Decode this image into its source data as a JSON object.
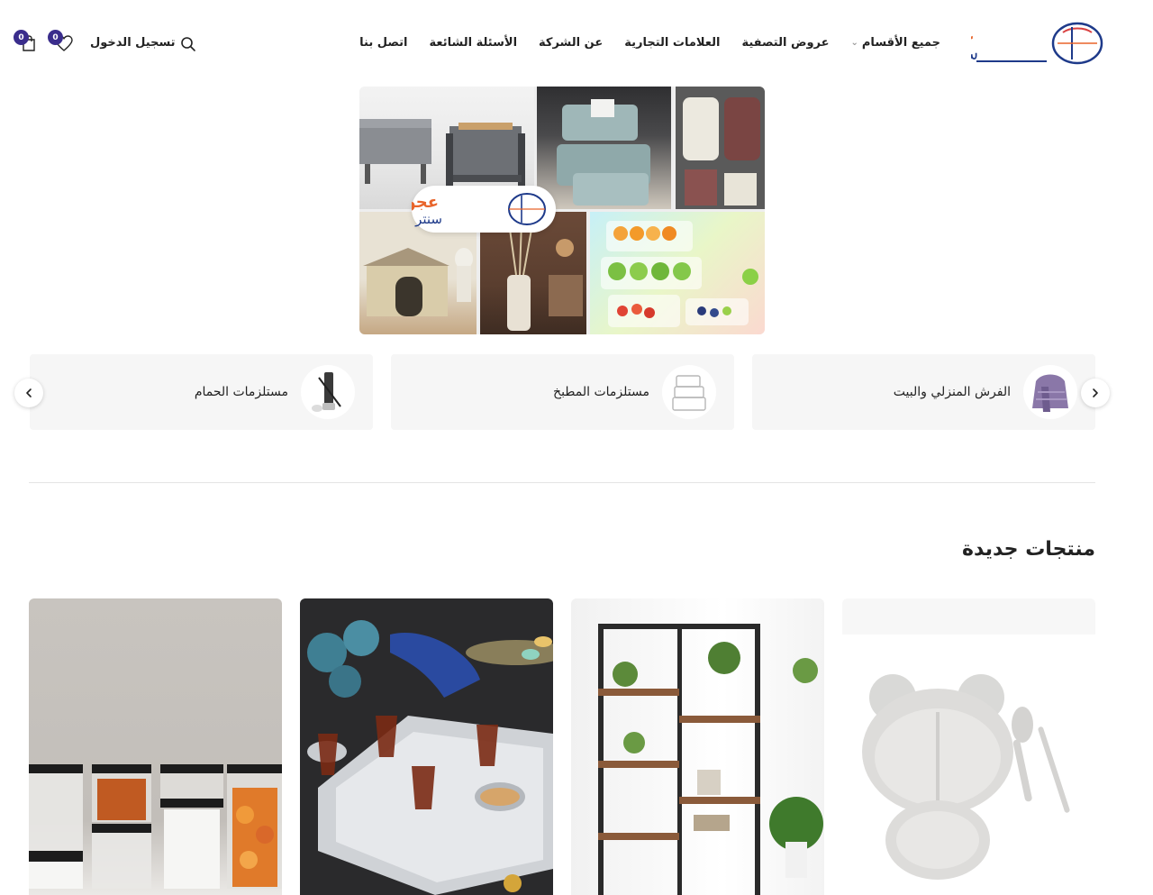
{
  "brand": {
    "name_top": "عجولي",
    "name_bottom": "سنتر"
  },
  "nav": {
    "items": [
      {
        "label": "جميع الأقسام",
        "has_dropdown": true
      },
      {
        "label": "عروض التصفية"
      },
      {
        "label": "العلامات التجارية"
      },
      {
        "label": "عن الشركة"
      },
      {
        "label": "الأسئلة الشائعة"
      },
      {
        "label": "اتصل بنا"
      }
    ]
  },
  "header_actions": {
    "login_label": "تسجيل الدخول",
    "wishlist_count": "0",
    "cart_count": "0"
  },
  "categories": [
    {
      "label": "الفرش المنزلي والبيت",
      "icon": "towel-icon"
    },
    {
      "label": "مستلزمات المطبخ",
      "icon": "food-container-icon"
    },
    {
      "label": "مستلزمات الحمام",
      "icon": "toilet-brush-icon"
    }
  ],
  "new_products": {
    "title": "منتجات جديدة",
    "items": [
      {
        "image": "kids-bear-plate-set"
      },
      {
        "image": "wooden-metal-shelf"
      },
      {
        "image": "tea-serving-tray"
      },
      {
        "image": "food-storage-jars"
      }
    ]
  },
  "colors": {
    "brand_orange": "#e8642a",
    "brand_blue": "#1e3a8a",
    "badge": "#3a2d8c",
    "card_bg": "#f6f6f6"
  }
}
